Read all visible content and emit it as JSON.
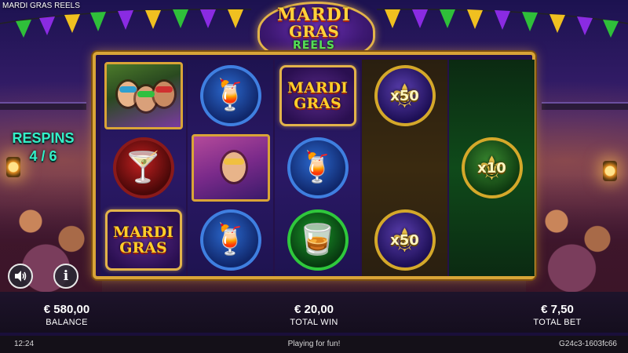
{
  "game": {
    "title": "MARDI GRAS REELS",
    "logo": {
      "line1": "MARDI",
      "line2": "GRAS",
      "line3": "REELS"
    }
  },
  "colors": {
    "frame_gold": "#d9a437",
    "respins_teal": "#34f0c8",
    "reel_green_bg": "#0f4a1a",
    "reel_dark_bg": "#3a2a10"
  },
  "respins": {
    "label": "RESPINS",
    "progress": "4 / 6"
  },
  "reels": [
    {
      "symbols": [
        {
          "type": "portrait-trio",
          "icon": "three-masked-ladies-icon"
        },
        {
          "type": "cocktail-red",
          "icon": "martini-glass-icon"
        },
        {
          "type": "mardi-gras-logo",
          "line1": "MARDI",
          "line2": "GRAS"
        }
      ]
    },
    {
      "symbols": [
        {
          "type": "cocktail-blue",
          "icon": "cocktail-glass-icon"
        },
        {
          "type": "portrait-single",
          "icon": "masked-lady-icon"
        },
        {
          "type": "cocktail-blue",
          "icon": "cocktail-glass-icon"
        }
      ]
    },
    {
      "symbols": [
        {
          "type": "mardi-gras-logo",
          "line1": "MARDI",
          "line2": "GRAS"
        },
        {
          "type": "cocktail-blue",
          "icon": "cocktail-glass-icon"
        },
        {
          "type": "cocktail-green",
          "icon": "mojito-glass-icon"
        }
      ]
    },
    {
      "symbols": [
        {
          "type": "multiplier",
          "value": "x50",
          "icon": "fleur-de-lis-icon"
        },
        {
          "type": "empty"
        },
        {
          "type": "multiplier",
          "value": "x50",
          "icon": "fleur-de-lis-icon"
        }
      ]
    },
    {
      "symbols": [
        {
          "type": "empty"
        },
        {
          "type": "multiplier",
          "value": "x10",
          "icon": "fleur-de-lis-icon"
        },
        {
          "type": "empty"
        }
      ]
    }
  ],
  "controls": {
    "sound_icon": "speaker-icon",
    "info_icon": "info-icon",
    "info_glyph": "i"
  },
  "stats": {
    "balance": {
      "value": "€ 580,00",
      "label": "BALANCE"
    },
    "total_win": {
      "value": "€ 20,00",
      "label": "TOTAL WIN"
    },
    "total_bet": {
      "value": "€ 7,50",
      "label": "TOTAL BET"
    }
  },
  "status": {
    "time": "12:24",
    "message": "Playing for fun!",
    "session_id": "G24c3-1603fc66"
  }
}
